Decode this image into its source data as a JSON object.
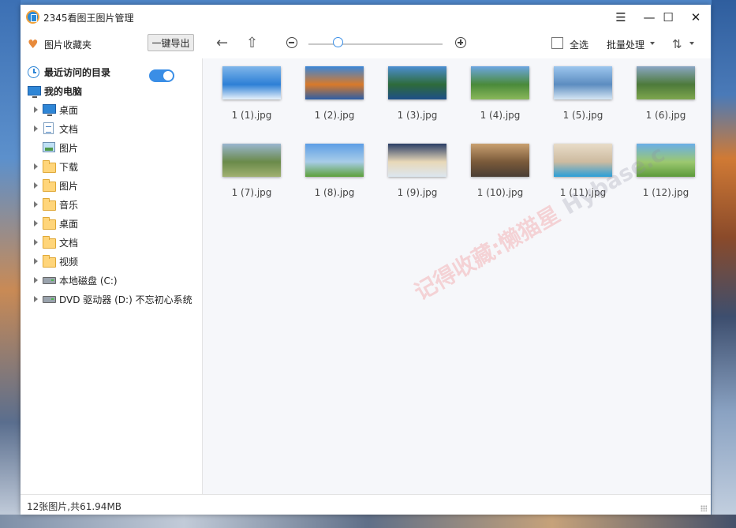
{
  "window": {
    "title": "2345看图王图片管理",
    "controls": [
      "menu",
      "minimize",
      "maximize",
      "close"
    ]
  },
  "toolbar": {
    "favorites_label": "图片收藏夹",
    "export_label": "一键导出",
    "select_all_label": "全选",
    "batch_label": "批量处理",
    "zoom_level": 0.22
  },
  "sidebar": {
    "recent_label": "最近访问的目录",
    "recent_toggle_on": true,
    "computer_label": "我的电脑",
    "items": [
      {
        "label": "桌面",
        "icon": "desktop-icon",
        "expandable": true
      },
      {
        "label": "文档",
        "icon": "document-icon",
        "expandable": true
      },
      {
        "label": "图片",
        "icon": "picture-icon",
        "expandable": false
      },
      {
        "label": "下载",
        "icon": "folder-icon",
        "expandable": true
      },
      {
        "label": "图片",
        "icon": "folder-icon",
        "expandable": true
      },
      {
        "label": "音乐",
        "icon": "folder-icon",
        "expandable": true
      },
      {
        "label": "桌面",
        "icon": "folder-icon",
        "expandable": true
      },
      {
        "label": "文档",
        "icon": "folder-icon",
        "expandable": true
      },
      {
        "label": "视频",
        "icon": "folder-icon",
        "expandable": true
      },
      {
        "label": "本地磁盘 (C:)",
        "icon": "drive-icon",
        "expandable": true
      },
      {
        "label": "DVD 驱动器 (D:) 不忘初心系统",
        "icon": "drive-icon",
        "expandable": true
      }
    ]
  },
  "thumbnails": [
    {
      "name": "1 (1).jpg",
      "colors": [
        "#7fb6ea",
        "#2d7fd6",
        "#e8f2fb"
      ]
    },
    {
      "name": "1 (2).jpg",
      "colors": [
        "#3a86d8",
        "#d97a2a",
        "#2d5ea6"
      ]
    },
    {
      "name": "1 (3).jpg",
      "colors": [
        "#4c8ed2",
        "#2e6b3a",
        "#1f4f88"
      ]
    },
    {
      "name": "1 (4).jpg",
      "colors": [
        "#6da6e2",
        "#4a8a3a",
        "#8ab85a"
      ]
    },
    {
      "name": "1 (5).jpg",
      "colors": [
        "#9cc6ee",
        "#5c8cc0",
        "#d6e6f4"
      ]
    },
    {
      "name": "1 (6).jpg",
      "colors": [
        "#8aa6c4",
        "#4d7a3a",
        "#7ea64e"
      ]
    },
    {
      "name": "1 (7).jpg",
      "colors": [
        "#9ab6d0",
        "#6a8a4a",
        "#a0b070"
      ]
    },
    {
      "name": "1 (8).jpg",
      "colors": [
        "#5d9ee6",
        "#a8cce8",
        "#5ca03a"
      ]
    },
    {
      "name": "1 (9).jpg",
      "colors": [
        "#2a3e66",
        "#e8d8b8",
        "#dce6f0"
      ]
    },
    {
      "name": "1 (10).jpg",
      "colors": [
        "#c9a070",
        "#7a5a3a",
        "#4a3e34"
      ]
    },
    {
      "name": "1 (11).jpg",
      "colors": [
        "#e8dcc8",
        "#cdbba0",
        "#2a9fd8"
      ]
    },
    {
      "name": "1 (12).jpg",
      "colors": [
        "#6aaee8",
        "#9cc870",
        "#5c9a3a"
      ]
    }
  ],
  "watermark": {
    "text": "记得收藏:懒猫星",
    "latin": "Hybase.c"
  },
  "status": {
    "text": "12张图片,共61.94MB"
  }
}
